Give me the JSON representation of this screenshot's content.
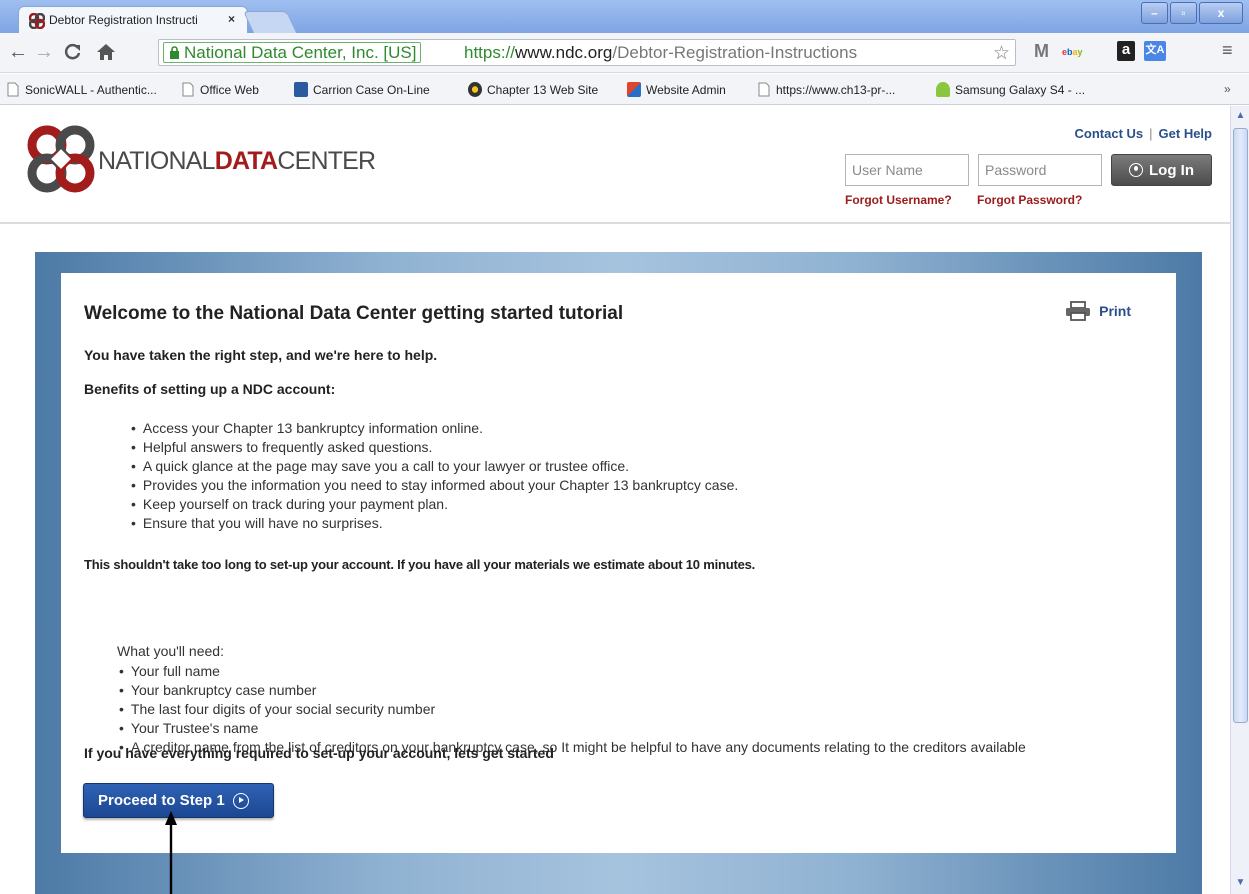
{
  "browser": {
    "tab_title": "Debtor Registration Instructi",
    "tab_close": "×",
    "window_buttons": [
      "–",
      "▫",
      "x"
    ],
    "ev_label": "National Data Center, Inc. [US]",
    "url_scheme": "https://",
    "url_host": "www.ndc.org",
    "url_path": "/Debtor-Registration-Instructions",
    "bookmarks": [
      "SonicWALL - Authentic...",
      "Office Web",
      "Carrion Case On-Line",
      "Chapter 13 Web Site",
      "Website Admin",
      "https://www.ch13-pr-...",
      "Samsung Galaxy S4 - ..."
    ],
    "bookmarks_more": "»"
  },
  "header": {
    "logo_prefix": "NATIONAL",
    "logo_bold": "DATA",
    "logo_suffix": "CENTER",
    "contact_us": "Contact Us",
    "get_help": "Get Help",
    "username_placeholder": "User Name",
    "password_placeholder": "Password",
    "login_label": "Log In",
    "forgot_username": "Forgot Username?",
    "forgot_password": "Forgot Password?"
  },
  "content": {
    "title": "Welcome to the National Data Center getting started tutorial",
    "print_label": "Print",
    "intro": "You have taken the right step, and we're here to help.",
    "benefits_heading": "Benefits of setting up a NDC account:",
    "benefits": [
      "Access your Chapter 13 bankruptcy information online.",
      "Helpful answers to frequently asked questions.",
      "A quick glance at the page may save you a call to your lawyer or trustee office.",
      "Provides you the information you need to stay informed about your Chapter 13 bankruptcy case.",
      "Keep yourself on track during your payment plan.",
      "Ensure that you will have no surprises."
    ],
    "time_note": "This shouldn't take too long to set-up your account. If you have all your materials we estimate about 10 minutes.",
    "needs_heading": "What you'll need:",
    "needs": [
      "Your full name",
      "Your bankruptcy case number",
      "The last four digits of your social security number",
      "Your Trustee's name",
      "A creditor name from the list of creditors on your bankruptcy case, so It might be helpful to have any documents relating to the creditors available"
    ],
    "ready_note": "If you have everything required to set-up your account, lets get started",
    "proceed_label": "Proceed to Step 1"
  }
}
